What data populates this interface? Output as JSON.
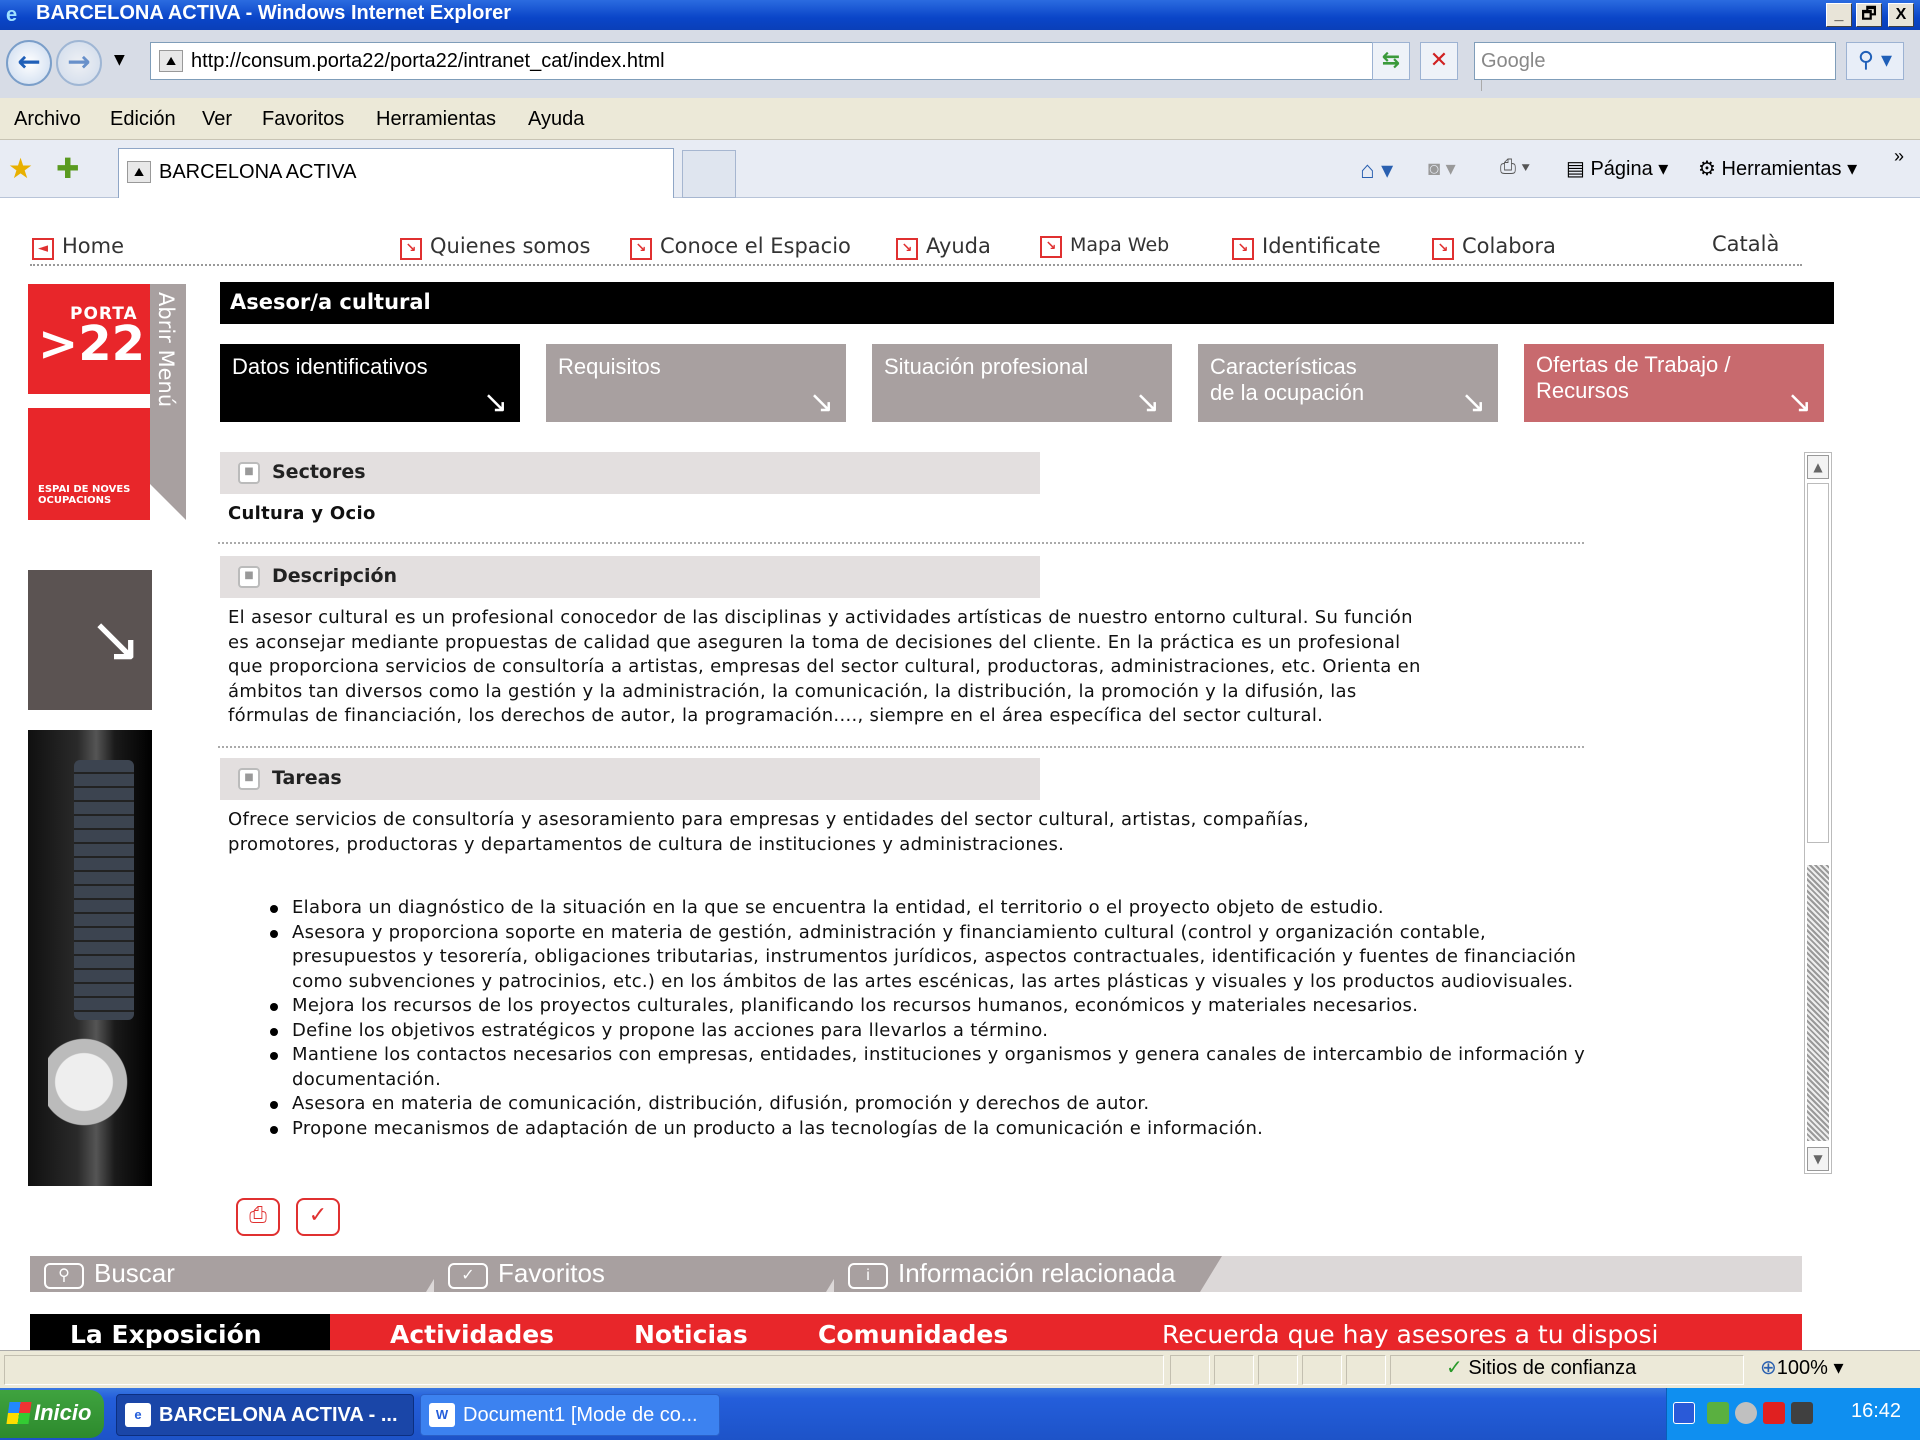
{
  "window": {
    "title": "BARCELONA ACTIVA - Windows Internet Explorer",
    "minimize": "_",
    "maximize": "🗗",
    "close": "X"
  },
  "browser": {
    "address": "http://consum.porta22/porta22/intranet_cat/index.html",
    "search_placeholder": "Google",
    "menu": [
      "Archivo",
      "Edición",
      "Ver",
      "Favoritos",
      "Herramientas",
      "Ayuda"
    ],
    "tab_title": "BARCELONA ACTIVA",
    "commands": {
      "page": "Página",
      "tools": "Herramientas"
    }
  },
  "site": {
    "nav": {
      "home": "Home",
      "quienes": "Quienes somos",
      "conoce": "Conoce el Espacio",
      "ayuda": "Ayuda",
      "mapa": "Mapa Web",
      "identificate": "Identificate",
      "colabora": "Colabora",
      "lang": "Català"
    },
    "logo": {
      "porta": "PORTA",
      "num": ">22",
      "espai": "ESPAI DE NOVES OCUPACIONS"
    },
    "abrir_menu": "Abrir Menú",
    "title": "Asesor/a cultural",
    "tabs": [
      {
        "label": "Datos identificativos",
        "color": "#000000"
      },
      {
        "label": "Requisitos",
        "color": "#a8a0a0"
      },
      {
        "label": "Situación profesional",
        "color": "#a8a0a0"
      },
      {
        "label": "Características de la ocupación",
        "color": "#a8a0a0"
      },
      {
        "label": "Ofertas de Trabajo / Recursos",
        "color": "#c86a6e"
      }
    ],
    "sections": {
      "sectores": {
        "title": "Sectores",
        "value": "Cultura y Ocio"
      },
      "descripcion": {
        "title": "Descripción",
        "lines": [
          "El asesor cultural es un profesional conocedor de las disciplinas y actividades artísticas de nuestro entorno cultural. Su función",
          "es aconsejar mediante propuestas de calidad que aseguren la toma de decisiones del cliente. En la práctica es un profesional",
          "que proporciona servicios de consultoría a artistas, empresas del sector cultural, productoras, administraciones, etc. Orienta en",
          "ámbitos tan diversos como la gestión y la administración, la comunicación, la distribución, la promoción y la difusión, las",
          "fórmulas de financiación, los derechos de autor, la programación...., siempre en el área específica del sector cultural."
        ]
      },
      "tareas": {
        "title": "Tareas",
        "intro": [
          "Ofrece servicios de consultoría y asesoramiento para empresas y entidades del sector cultural, artistas, compañías,",
          "promotores, productoras y departamentos de cultura de instituciones y administraciones."
        ],
        "items": [
          "Elabora un diagnóstico de la situación en la que se encuentra la entidad, el territorio o el proyecto objeto de estudio.",
          "Asesora y proporciona soporte en materia de gestión, administración y financiamiento cultural (control y organización contable, presupuestos y tesorería, obligaciones tributarias, instrumentos jurídicos, aspectos contractuales, identificación y fuentes de financiación como subvenciones y patrocinios, etc.) en los ámbitos de las artes escénicas, las artes plásticas y visuales y los productos audiovisuales.",
          "Mejora los recursos de los proyectos culturales, planificando los recursos humanos, económicos y materiales necesarios.",
          "Define los objetivos estratégicos y propone las acciones para llevarlos a término.",
          "Mantiene los contactos necesarios con empresas, entidades, instituciones y organismos y genera canales de intercambio de información y documentación.",
          "Asesora en materia de comunicación, distribución, difusión, promoción y derechos de autor.",
          "Propone mecanismos de adaptación de un producto a las tecnologías de la comunicación e información."
        ]
      }
    },
    "bottom_tabs": {
      "buscar": "Buscar",
      "favoritos": "Favoritos",
      "info": "Información relacionada"
    },
    "red_bar": {
      "exposicion": "La Exposición",
      "actividades": "Actividades",
      "noticias": "Noticias",
      "comunidades": "Comunidades",
      "recuerda": "Recuerda que hay asesores a tu disposi"
    }
  },
  "status": {
    "zone": "Sitios de confianza",
    "zoom": "100%"
  },
  "taskbar": {
    "start": "Inicio",
    "tasks": [
      "BARCELONA ACTIVA - ...",
      "Document1 [Mode de co..."
    ],
    "clock": "16:42"
  }
}
